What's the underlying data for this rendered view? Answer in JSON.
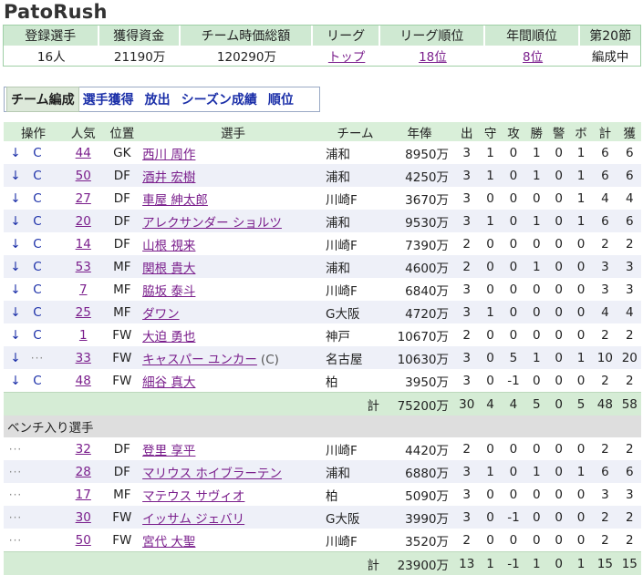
{
  "app_title": "PatoRush",
  "summary": {
    "headers": [
      "登録選手",
      "獲得資金",
      "チーム時価総額",
      "リーグ",
      "リーグ順位",
      "年間順位",
      "第20節"
    ],
    "values": [
      "16人",
      "21190万",
      "120290万",
      "トップ",
      "18位",
      "8位",
      "編成中"
    ]
  },
  "tabs": [
    "チーム編成",
    "選手獲得",
    "放出",
    "シーズン成績",
    "順位"
  ],
  "roster": {
    "headers": [
      "操作",
      "人気",
      "位置",
      "選手",
      "チーム",
      "年俸",
      "出",
      "守",
      "攻",
      "勝",
      "警",
      "ボ",
      "計",
      "獲"
    ],
    "starters": [
      {
        "op1": "↓",
        "op2": "C",
        "pop": "44",
        "pos": "GK",
        "name": "西川 周作",
        "cap": "",
        "team": "浦和",
        "salary": "8950万",
        "s1": "3",
        "s2": "1",
        "s3": "0",
        "s4": "1",
        "s5": "0",
        "s6": "1",
        "s7": "6",
        "s8": "6"
      },
      {
        "op1": "↓",
        "op2": "C",
        "pop": "50",
        "pos": "DF",
        "name": "酒井 宏樹",
        "cap": "",
        "team": "浦和",
        "salary": "4250万",
        "s1": "3",
        "s2": "1",
        "s3": "0",
        "s4": "1",
        "s5": "0",
        "s6": "1",
        "s7": "6",
        "s8": "6"
      },
      {
        "op1": "↓",
        "op2": "C",
        "pop": "27",
        "pos": "DF",
        "name": "車屋 紳太郎",
        "cap": "",
        "team": "川崎F",
        "salary": "3670万",
        "s1": "3",
        "s2": "0",
        "s3": "0",
        "s4": "0",
        "s5": "0",
        "s6": "1",
        "s7": "4",
        "s8": "4"
      },
      {
        "op1": "↓",
        "op2": "C",
        "pop": "20",
        "pos": "DF",
        "name": "アレクサンダー ショルツ",
        "cap": "",
        "team": "浦和",
        "salary": "9530万",
        "s1": "3",
        "s2": "1",
        "s3": "0",
        "s4": "1",
        "s5": "0",
        "s6": "1",
        "s7": "6",
        "s8": "6"
      },
      {
        "op1": "↓",
        "op2": "C",
        "pop": "14",
        "pos": "DF",
        "name": "山根 視来",
        "cap": "",
        "team": "川崎F",
        "salary": "7390万",
        "s1": "2",
        "s2": "0",
        "s3": "0",
        "s4": "0",
        "s5": "0",
        "s6": "0",
        "s7": "2",
        "s8": "2"
      },
      {
        "op1": "↓",
        "op2": "C",
        "pop": "53",
        "pos": "MF",
        "name": "関根 貴大",
        "cap": "",
        "team": "浦和",
        "salary": "4600万",
        "s1": "2",
        "s2": "0",
        "s3": "0",
        "s4": "1",
        "s5": "0",
        "s6": "0",
        "s7": "3",
        "s8": "3"
      },
      {
        "op1": "↓",
        "op2": "C",
        "pop": "7",
        "pos": "MF",
        "name": "脇坂 泰斗",
        "cap": "",
        "team": "川崎F",
        "salary": "6840万",
        "s1": "3",
        "s2": "0",
        "s3": "0",
        "s4": "0",
        "s5": "0",
        "s6": "0",
        "s7": "3",
        "s8": "3"
      },
      {
        "op1": "↓",
        "op2": "C",
        "pop": "25",
        "pos": "MF",
        "name": "ダワン",
        "cap": "",
        "team": "G大阪",
        "salary": "4720万",
        "s1": "3",
        "s2": "1",
        "s3": "0",
        "s4": "0",
        "s5": "0",
        "s6": "0",
        "s7": "4",
        "s8": "4"
      },
      {
        "op1": "↓",
        "op2": "C",
        "pop": "1",
        "pos": "FW",
        "name": "大迫 勇也",
        "cap": "",
        "team": "神戸",
        "salary": "10670万",
        "s1": "2",
        "s2": "0",
        "s3": "0",
        "s4": "0",
        "s5": "0",
        "s6": "0",
        "s7": "2",
        "s8": "2"
      },
      {
        "op1": "↓",
        "op2": "···",
        "pop": "33",
        "pos": "FW",
        "name": "キャスパー ユンカー",
        "cap": "(C)",
        "team": "名古屋",
        "salary": "10630万",
        "s1": "3",
        "s2": "0",
        "s3": "5",
        "s4": "1",
        "s5": "0",
        "s6": "1",
        "s7": "10",
        "s8": "20"
      },
      {
        "op1": "↓",
        "op2": "C",
        "pop": "48",
        "pos": "FW",
        "name": "細谷 真大",
        "cap": "",
        "team": "柏",
        "salary": "3950万",
        "s1": "3",
        "s2": "0",
        "s3": "-1",
        "s4": "0",
        "s5": "0",
        "s6": "0",
        "s7": "2",
        "s8": "2"
      }
    ],
    "starters_total": {
      "label": "計",
      "salary": "75200万",
      "s1": "30",
      "s2": "4",
      "s3": "4",
      "s4": "5",
      "s5": "0",
      "s6": "5",
      "s7": "48",
      "s8": "58"
    },
    "bench_header": "ベンチ入り選手",
    "bench": [
      {
        "op1": "···",
        "op2": "",
        "pop": "32",
        "pos": "DF",
        "name": "登里 享平",
        "cap": "",
        "team": "川崎F",
        "salary": "4420万",
        "s1": "2",
        "s2": "0",
        "s3": "0",
        "s4": "0",
        "s5": "0",
        "s6": "0",
        "s7": "2",
        "s8": "2"
      },
      {
        "op1": "···",
        "op2": "",
        "pop": "28",
        "pos": "DF",
        "name": "マリウス ホイブラーテン",
        "cap": "",
        "team": "浦和",
        "salary": "6880万",
        "s1": "3",
        "s2": "1",
        "s3": "0",
        "s4": "1",
        "s5": "0",
        "s6": "1",
        "s7": "6",
        "s8": "6"
      },
      {
        "op1": "···",
        "op2": "",
        "pop": "17",
        "pos": "MF",
        "name": "マテウス サヴィオ",
        "cap": "",
        "team": "柏",
        "salary": "5090万",
        "s1": "3",
        "s2": "0",
        "s3": "0",
        "s4": "0",
        "s5": "0",
        "s6": "0",
        "s7": "3",
        "s8": "3"
      },
      {
        "op1": "···",
        "op2": "",
        "pop": "30",
        "pos": "FW",
        "name": "イッサム ジェバリ",
        "cap": "",
        "team": "G大阪",
        "salary": "3990万",
        "s1": "3",
        "s2": "0",
        "s3": "-1",
        "s4": "0",
        "s5": "0",
        "s6": "0",
        "s7": "2",
        "s8": "2"
      },
      {
        "op1": "···",
        "op2": "",
        "pop": "50",
        "pos": "FW",
        "name": "宮代 大聖",
        "cap": "",
        "team": "川崎F",
        "salary": "3520万",
        "s1": "2",
        "s2": "0",
        "s3": "0",
        "s4": "0",
        "s5": "0",
        "s6": "0",
        "s7": "2",
        "s8": "2"
      }
    ],
    "bench_total": {
      "label": "計",
      "salary": "23900万",
      "s1": "13",
      "s2": "1",
      "s3": "-1",
      "s4": "1",
      "s5": "0",
      "s6": "1",
      "s7": "15",
      "s8": "15"
    }
  }
}
